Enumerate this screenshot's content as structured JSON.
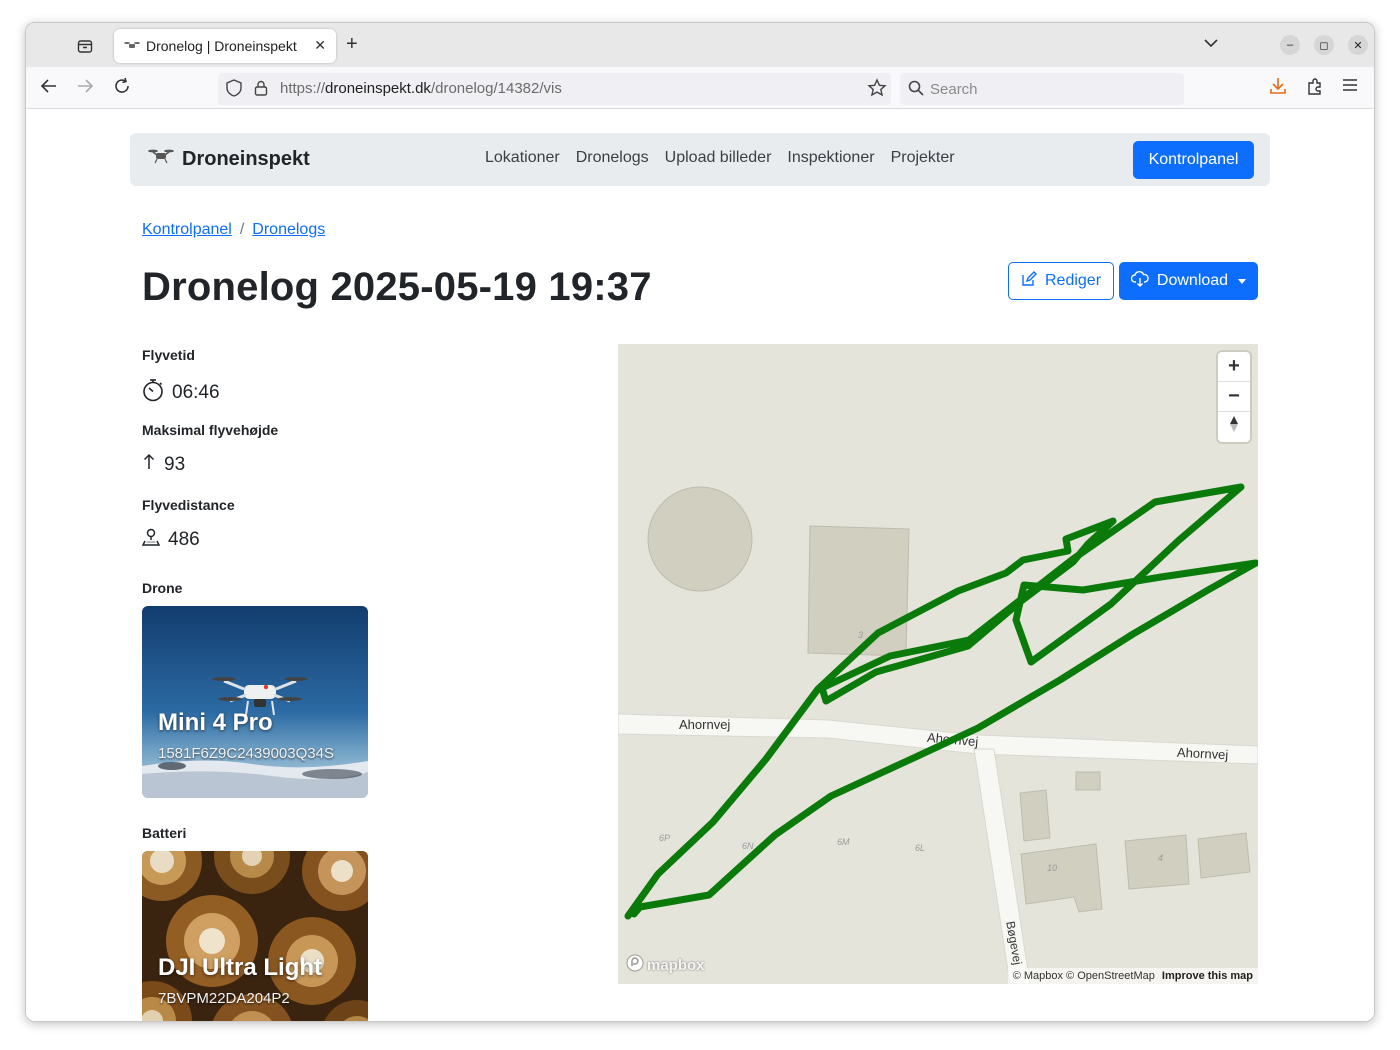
{
  "browser": {
    "tab_title": "Dronelog | Droneinspekt",
    "url_prefix": "https://",
    "url_host": "droneinspekt.dk",
    "url_path": "/dronelog/14382/vis",
    "search_placeholder": "Search"
  },
  "site": {
    "brand": "Droneinspekt",
    "nav": [
      "Lokationer",
      "Dronelogs",
      "Upload billeder",
      "Inspektioner",
      "Projekter"
    ],
    "cta": "Kontrolpanel"
  },
  "breadcrumb": {
    "items": [
      "Kontrolpanel",
      "Dronelogs"
    ],
    "separator": "/"
  },
  "title": "Dronelog 2025-05-19 19:37",
  "actions": {
    "edit": "Rediger",
    "download": "Download"
  },
  "stats": [
    {
      "label": "Flyvetid",
      "value": "06:46",
      "icon": "stopwatch-icon"
    },
    {
      "label": "Maksimal flyvehøjde",
      "value": "93",
      "icon": "arrow-up-icon"
    },
    {
      "label": "Flyvedistance",
      "value": "486",
      "icon": "person-pin-icon"
    }
  ],
  "drone": {
    "section": "Drone",
    "name": "Mini 4 Pro",
    "serial": "1581F6Z9C2439003Q34S"
  },
  "battery": {
    "section": "Batteri",
    "name": "DJI Ultra Light",
    "serial": "7BVPM22DA204P2"
  },
  "map": {
    "street_labels": [
      "Ahornvej",
      "Ahornvej",
      "Ahornvej",
      "Bøgevej"
    ],
    "house_numbers": [
      "3",
      "6P",
      "6N",
      "6M",
      "6L",
      "10",
      "4"
    ],
    "attribution": "© Mapbox © OpenStreetMap",
    "improve": "Improve this map",
    "logo": "mapbox",
    "zoom_in": "+",
    "zoom_out": "−",
    "flight_path_color": "#0a7a0a"
  },
  "colors": {
    "primary": "#0d6efd",
    "navbar_bg": "#e9ecef",
    "map_bg": "#e5e4da"
  }
}
